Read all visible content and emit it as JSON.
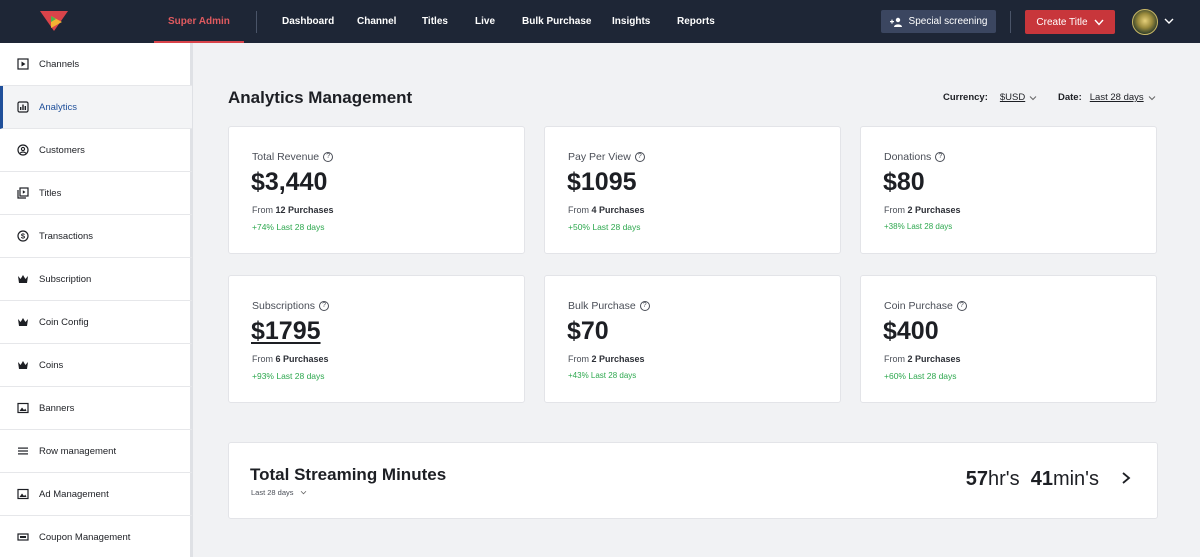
{
  "nav": {
    "items": [
      {
        "label": "Super Admin",
        "active": true
      },
      {
        "label": "Dashboard"
      },
      {
        "label": "Channel"
      },
      {
        "label": "Titles"
      },
      {
        "label": "Live"
      },
      {
        "label": "Bulk Purchase"
      },
      {
        "label": "Insights"
      },
      {
        "label": "Reports"
      }
    ],
    "special_screening": "Special screening",
    "create_title": "Create Title"
  },
  "sidebar": {
    "items": [
      {
        "label": "Channels",
        "icon": "play-square-icon"
      },
      {
        "label": "Analytics",
        "icon": "bar-chart-icon",
        "active": true
      },
      {
        "label": "Customers",
        "icon": "user-circle-icon"
      },
      {
        "label": "Titles",
        "icon": "titles-icon"
      },
      {
        "label": "Transactions",
        "icon": "dollar-circle-icon"
      },
      {
        "label": "Subscription",
        "icon": "crown-icon"
      },
      {
        "label": "Coin Config",
        "icon": "crown-icon"
      },
      {
        "label": "Coins",
        "icon": "crown-icon"
      },
      {
        "label": "Banners",
        "icon": "image-icon"
      },
      {
        "label": "Row management",
        "icon": "menu-icon"
      },
      {
        "label": "Ad Management",
        "icon": "image-icon"
      },
      {
        "label": "Coupon Management",
        "icon": "ticket-icon"
      }
    ]
  },
  "main": {
    "title": "Analytics Management",
    "currency_label": "Currency:",
    "currency_value": "$USD",
    "date_label": "Date:",
    "date_value": "Last 28 days",
    "cards": [
      {
        "title": "Total Revenue",
        "value": "$3,440",
        "from": "From",
        "count": "12 Purchases",
        "growth": "+74% Last 28 days"
      },
      {
        "title": "Pay Per View",
        "value": "$1095",
        "from": "From",
        "count": "4 Purchases",
        "growth": "+50% Last 28 days"
      },
      {
        "title": "Donations",
        "value": "$80",
        "from": "From",
        "count": "2 Purchases",
        "growth": "+38% Last  28 days"
      },
      {
        "title": "Subscriptions",
        "value": "$1795",
        "from": "From",
        "count": "6 Purchases",
        "growth": "+93% Last 28 days"
      },
      {
        "title": "Bulk Purchase",
        "value": "$70",
        "from": "From",
        "count": "2 Purchases",
        "growth": "+43% Last  28 days"
      },
      {
        "title": "Coin Purchase",
        "value": "$400",
        "from": "From",
        "count": "2 Purchases",
        "growth": "+60% Last 28 days"
      }
    ],
    "streaming": {
      "title": "Total Streaming Minutes",
      "period": "Last 28 days",
      "hours": "57",
      "hours_unit": "hr's",
      "minutes": "41",
      "minutes_unit": "min's"
    }
  },
  "colors": {
    "nav_bg": "#1e2636",
    "accent_red": "#c8363b",
    "active_blue": "#1f4f9a",
    "growth_green": "#2ea84f"
  }
}
